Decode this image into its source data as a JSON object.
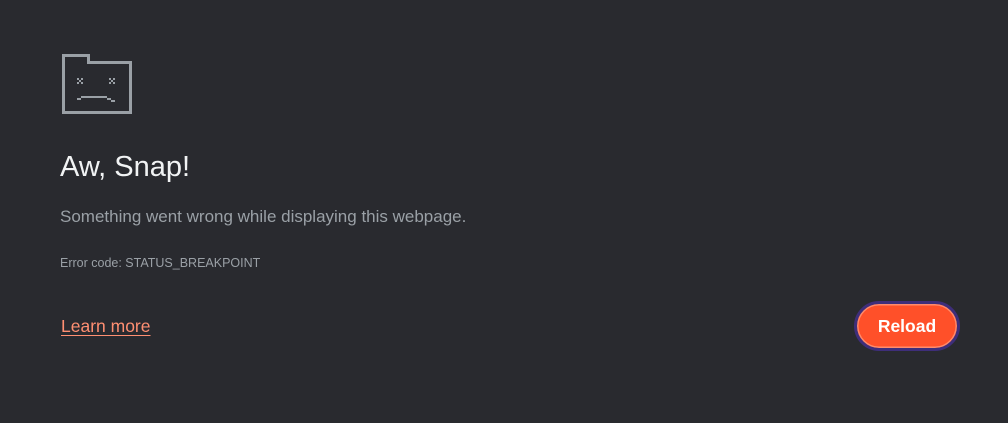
{
  "error_page": {
    "icon": "sad-folder-icon",
    "title": "Aw, Snap!",
    "message": "Something went wrong while displaying this webpage.",
    "error_code": "Error code: STATUS_BREAKPOINT",
    "learn_more_label": "Learn more",
    "reload_label": "Reload"
  },
  "colors": {
    "background": "#292a2f",
    "title": "#f1f3f4",
    "secondary_text": "#9aa0a6",
    "link": "#ff8f72",
    "button_fill": "#ff5029",
    "button_focus_ring": "#3e2e7a",
    "icon": "#9aa0a6"
  }
}
